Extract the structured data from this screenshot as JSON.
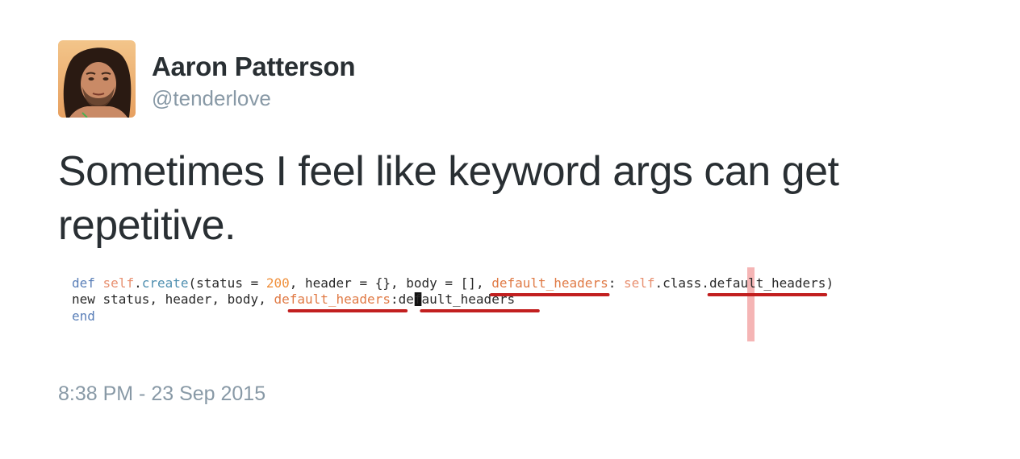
{
  "tweet": {
    "author": {
      "name": "Aaron Patterson",
      "handle": "@tenderlove"
    },
    "text": "Sometimes I feel like keyword args can get repetitive.",
    "timestamp": "8:38 PM - 23 Sep 2015"
  },
  "code_image": {
    "lines": [
      {
        "tokens": [
          {
            "text": "def",
            "role": "keyword"
          },
          {
            "text": " "
          },
          {
            "text": "self",
            "role": "self"
          },
          {
            "text": ".",
            "role": "plain"
          },
          {
            "text": "create",
            "role": "method"
          },
          {
            "text": "(status = ",
            "role": "plain"
          },
          {
            "text": "200",
            "role": "number"
          },
          {
            "text": ", header = {}, body = [], ",
            "role": "plain"
          },
          {
            "text": "default_headers",
            "role": "symbol"
          },
          {
            "text": ": ",
            "role": "plain"
          },
          {
            "text": "self",
            "role": "self"
          },
          {
            "text": ".class.",
            "role": "plain"
          },
          {
            "text": "default_headers",
            "role": "plain"
          },
          {
            "text": ")",
            "role": "plain"
          }
        ]
      },
      {
        "tokens": [
          {
            "text": "  new status, header, body, ",
            "role": "plain"
          },
          {
            "text": "default_headers",
            "role": "symbol"
          },
          {
            "text": ":",
            "role": "plain"
          },
          {
            "text": " ",
            "role": "cursor"
          },
          {
            "text": "default_headers",
            "role": "plain"
          }
        ]
      },
      {
        "tokens": [
          {
            "text": "end",
            "role": "keyword"
          }
        ]
      }
    ],
    "colors": {
      "keyword": "#5a7fb8",
      "self": "#e89070",
      "method": "#4f8fb0",
      "number": "#f0903c",
      "symbol": "#e07a45",
      "plain": "#2a2a2a",
      "underline": "#c21f1f",
      "margin_guide": "#f5b5b5",
      "cursor": "#111111"
    }
  },
  "colors": {
    "text_primary": "#292f33",
    "text_secondary": "#8899a6",
    "background": "#ffffff"
  }
}
